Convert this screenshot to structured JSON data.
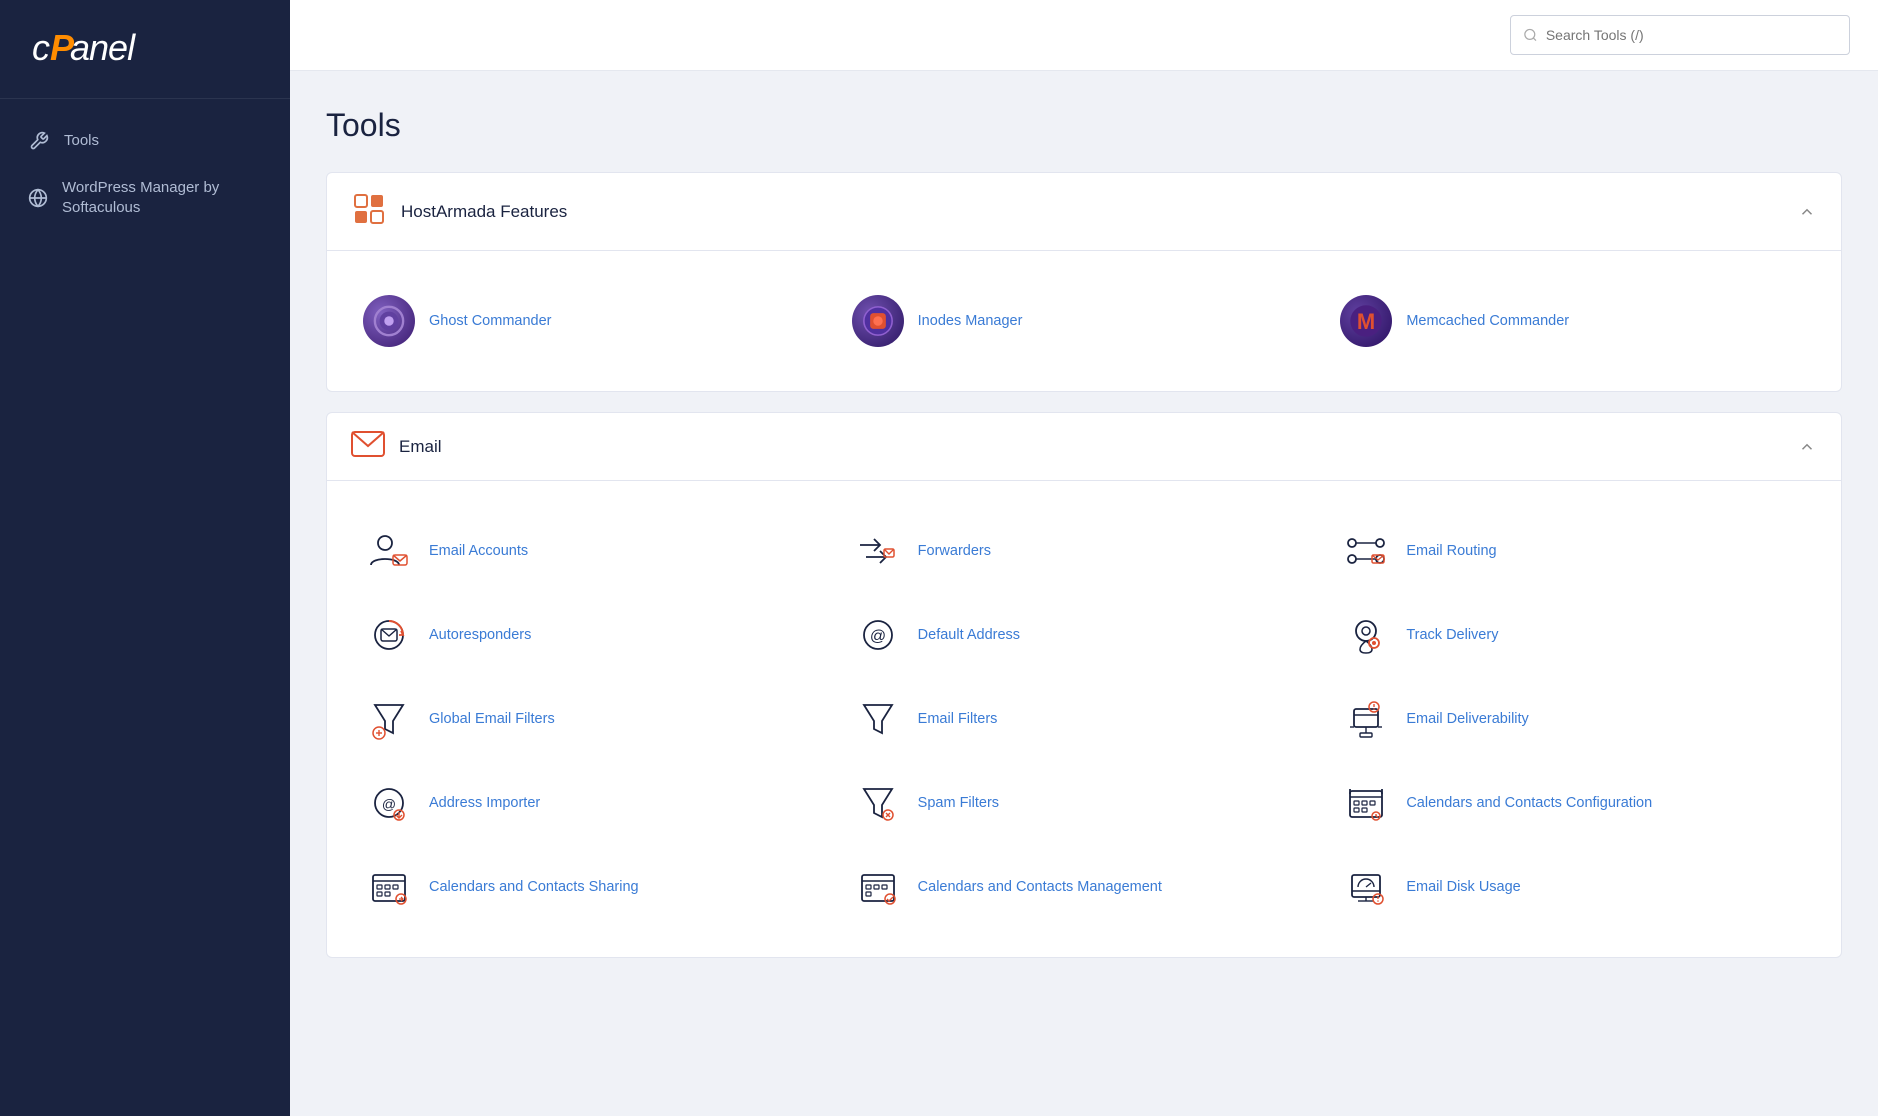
{
  "sidebar": {
    "logo": "cPanel",
    "items": [
      {
        "id": "tools",
        "label": "Tools",
        "icon": "tools-icon"
      },
      {
        "id": "wordpress",
        "label": "WordPress Manager by Softaculous",
        "icon": "wordpress-icon"
      }
    ]
  },
  "topbar": {
    "search_placeholder": "Search Tools (/)"
  },
  "main": {
    "page_title": "Tools",
    "sections": [
      {
        "id": "hostarmada",
        "title": "HostArmada Features",
        "icon": "grid-icon",
        "tools": [
          {
            "id": "ghost-commander",
            "label": "Ghost Commander"
          },
          {
            "id": "inodes-manager",
            "label": "Inodes Manager"
          },
          {
            "id": "memcached-commander",
            "label": "Memcached Commander"
          }
        ]
      },
      {
        "id": "email",
        "title": "Email",
        "icon": "email-icon",
        "tools": [
          {
            "id": "email-accounts",
            "label": "Email Accounts"
          },
          {
            "id": "forwarders",
            "label": "Forwarders"
          },
          {
            "id": "email-routing",
            "label": "Email Routing"
          },
          {
            "id": "autoresponders",
            "label": "Autoresponders"
          },
          {
            "id": "default-address",
            "label": "Default Address"
          },
          {
            "id": "track-delivery",
            "label": "Track Delivery"
          },
          {
            "id": "global-email-filters",
            "label": "Global Email Filters"
          },
          {
            "id": "email-filters",
            "label": "Email Filters"
          },
          {
            "id": "email-deliverability",
            "label": "Email Deliverability"
          },
          {
            "id": "address-importer",
            "label": "Address Importer"
          },
          {
            "id": "spam-filters",
            "label": "Spam Filters"
          },
          {
            "id": "calendars-contacts-configuration",
            "label": "Calendars and Contacts Configuration"
          },
          {
            "id": "calendars-contacts-sharing",
            "label": "Calendars and Contacts Sharing"
          },
          {
            "id": "calendars-contacts-management",
            "label": "Calendars and Contacts Management"
          },
          {
            "id": "email-disk-usage",
            "label": "Email Disk Usage"
          }
        ]
      }
    ]
  }
}
